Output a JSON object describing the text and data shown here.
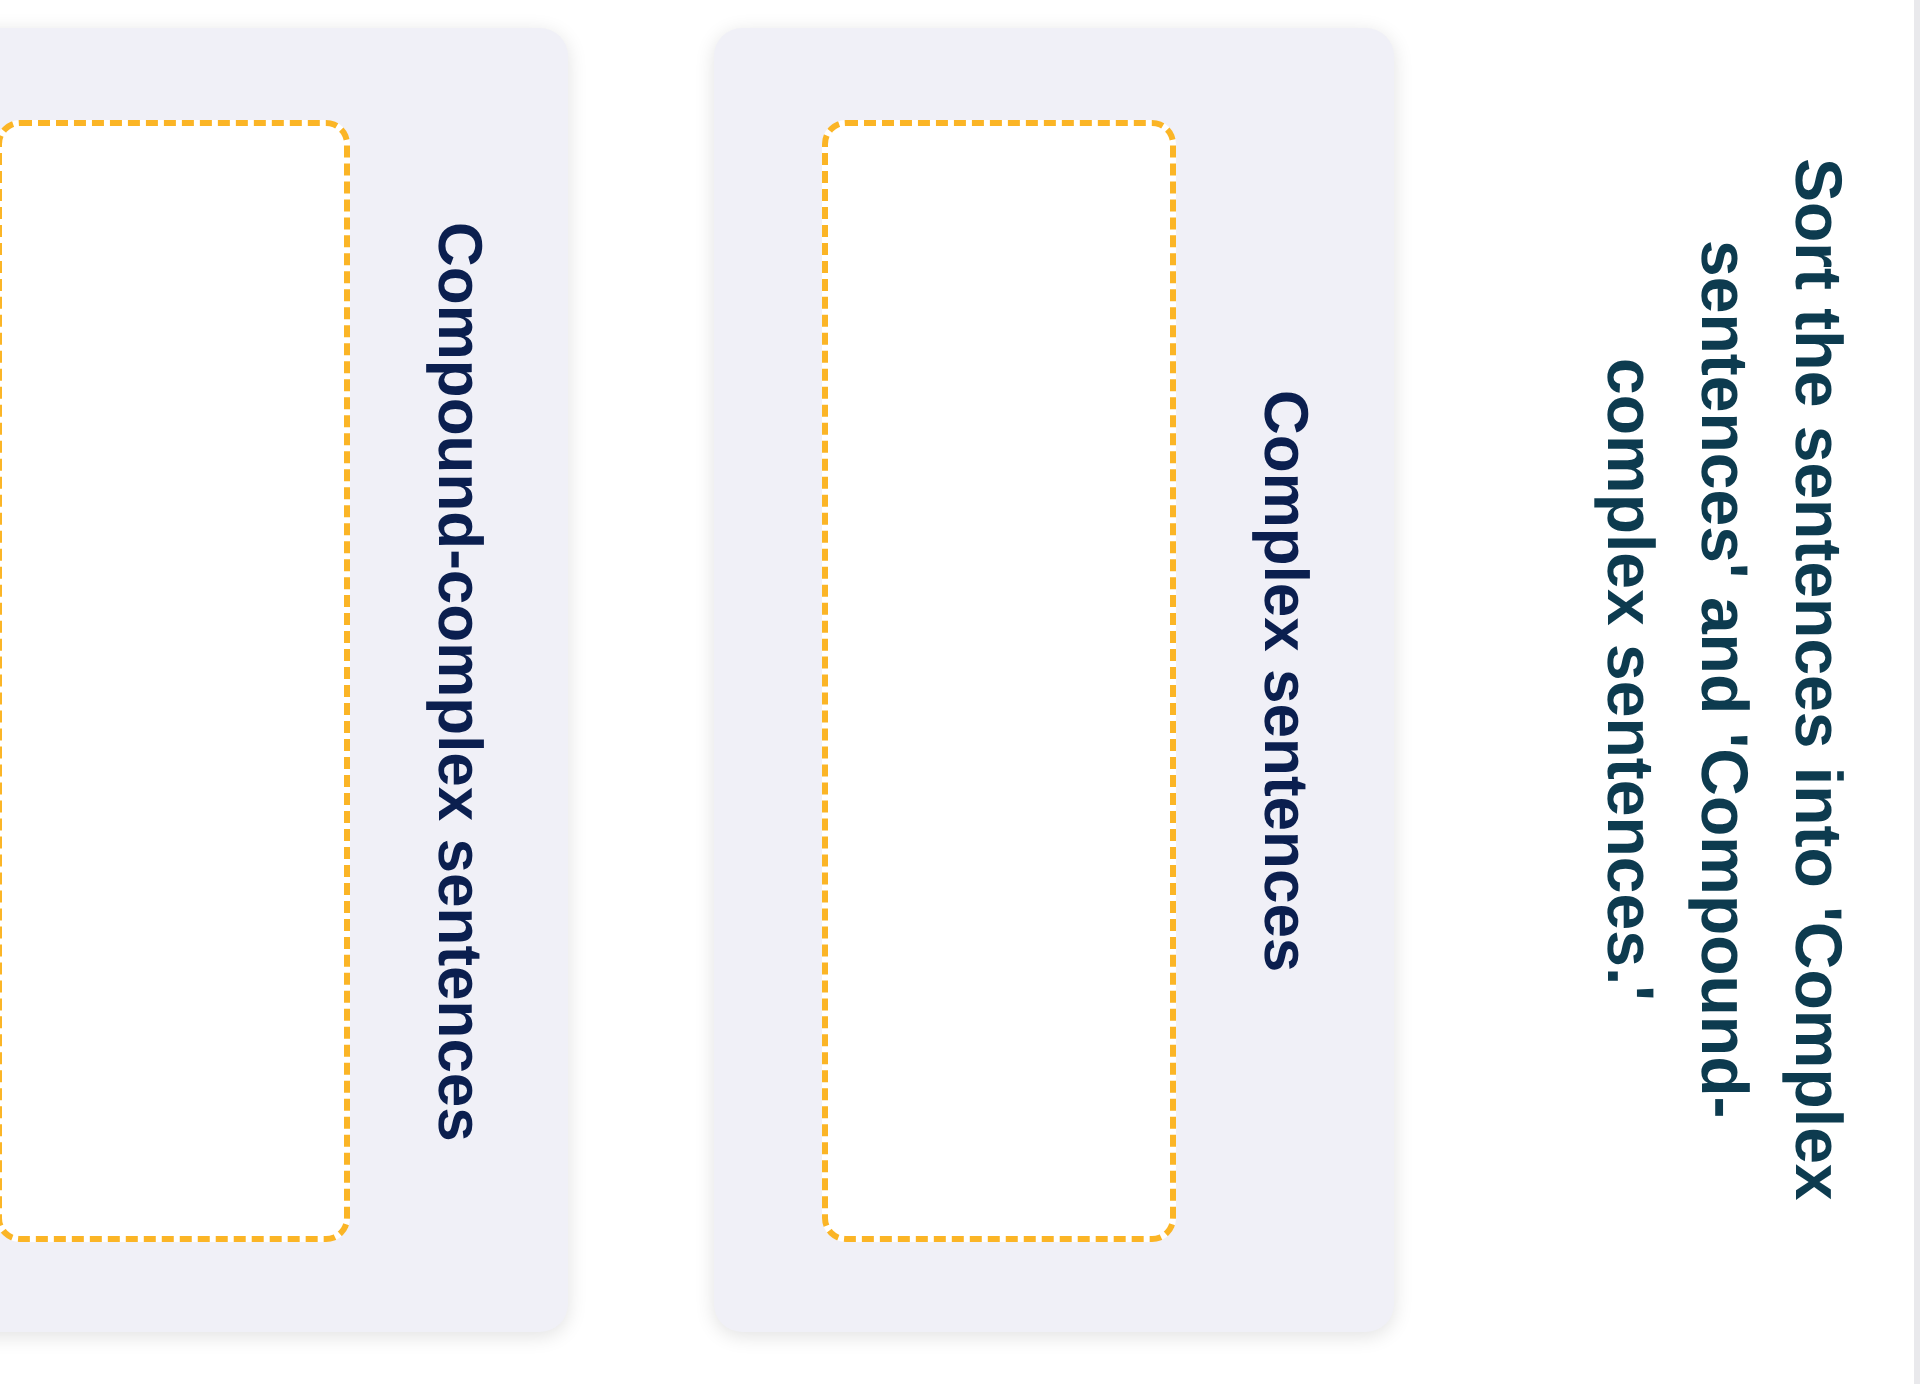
{
  "instruction": "Sort the sentences into 'Complex sentences' and 'Compound-complex sentences.'",
  "categories": [
    {
      "label": "Complex sentences"
    },
    {
      "label": "Compound-complex sentences"
    }
  ]
}
